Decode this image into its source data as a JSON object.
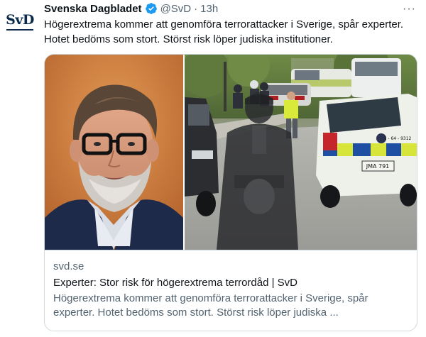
{
  "tweet": {
    "author_name": "Svenska Dagbladet",
    "handle": "@SvD",
    "separator": "·",
    "time": "13h",
    "more": "···",
    "text": "Högerextrema kommer att genomföra terrorattacker i Sverige, spår experter. Hotet bedöms som stort. Störst risk löper judiska institutioner.",
    "avatar_text": "SvD"
  },
  "card": {
    "domain": "svd.se",
    "title": "Experter: Stor risk för högerextrema terrordåd | SvD",
    "description": "Högerextrema kommer att genomföra terrorattacker i Sverige, spår experter. Hotet bedöms som stort. Störst risk löper judiska ...",
    "police_plate": "JMA 791",
    "police_number": "1 - 64 - 9312"
  },
  "colors": {
    "verified": "#1d9bf0",
    "logo": "#0b2a4a",
    "muted": "#536471"
  }
}
